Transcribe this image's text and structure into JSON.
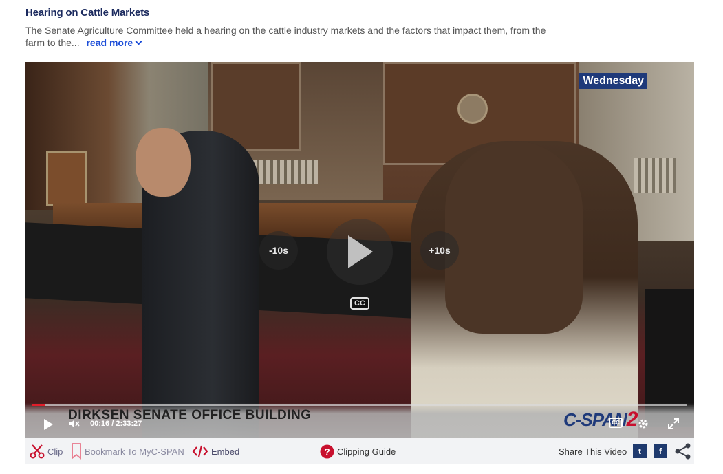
{
  "header": {
    "title": "Hearing on Cattle Markets",
    "description": "The Senate Agriculture Committee held a hearing on the cattle industry markets and the factors that impact them, from the farm to the...",
    "read_more": "read more"
  },
  "player": {
    "day_badge": "Wednesday",
    "skip_back": "-10s",
    "skip_forward": "+10s",
    "cc_label": "CC",
    "lower_third": "DIRKSEN SENATE OFFICE BUILDING",
    "logo_text": "C-SPAN",
    "logo_number": "2",
    "current_time": "00:16",
    "time_separator": "/",
    "duration": "2:33:27",
    "progress_fraction": 0.002
  },
  "toolbar": {
    "clip": "Clip",
    "bookmark": "Bookmark To MyC-SPAN",
    "embed": "Embed",
    "clipping_guide": "Clipping Guide",
    "share_label": "Share This Video",
    "twitter": "t",
    "facebook": "f"
  },
  "colors": {
    "title": "#1b2a5e",
    "link": "#1d4ed8",
    "brand_blue": "#1f3a7a",
    "brand_red": "#c8102e",
    "progress": "#e11d2a"
  }
}
